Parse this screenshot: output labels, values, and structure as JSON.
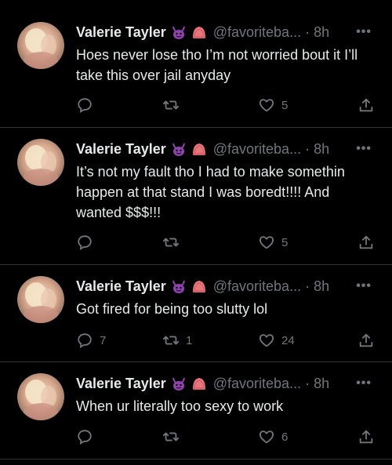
{
  "tweets": [
    {
      "name": "Valerie Tayler",
      "handle": "@favoriteba...",
      "sep": "·",
      "time": "8h",
      "more": "•••",
      "text": "Hoes never lose tho I’m not worried bout it I’ll take this over jail anyday",
      "replies": "",
      "retweets": "",
      "likes": "5"
    },
    {
      "name": "Valerie Tayler",
      "handle": "@favoriteba...",
      "sep": "·",
      "time": "8h",
      "more": "•••",
      "text": "It’s not my fault tho I had to make somethin happen at that stand I was boredt!!!! And wanted $$$!!!",
      "replies": "",
      "retweets": "",
      "likes": "5"
    },
    {
      "name": "Valerie Tayler",
      "handle": "@favoriteba...",
      "sep": "·",
      "time": "8h",
      "more": "•••",
      "text": "Got fired for being too slutty lol",
      "replies": "7",
      "retweets": "1",
      "likes": "24"
    },
    {
      "name": "Valerie Tayler",
      "handle": "@favoriteba...",
      "sep": "·",
      "time": "8h",
      "more": "•••",
      "text": "When ur literally too sexy to work",
      "replies": "",
      "retweets": "",
      "likes": "6"
    }
  ],
  "icons": {
    "devil_badge": "purple-devil-icon",
    "pink_badge": "pink-hat-icon",
    "reply": "reply-icon",
    "retweet": "retweet-icon",
    "like": "heart-icon",
    "share": "share-icon"
  },
  "colors": {
    "background": "#000000",
    "text": "#e7e9ea",
    "muted": "#71767b",
    "divider": "#2f3336",
    "devil_purple": "#8e44ad",
    "pink_badge": "#e8747c"
  }
}
